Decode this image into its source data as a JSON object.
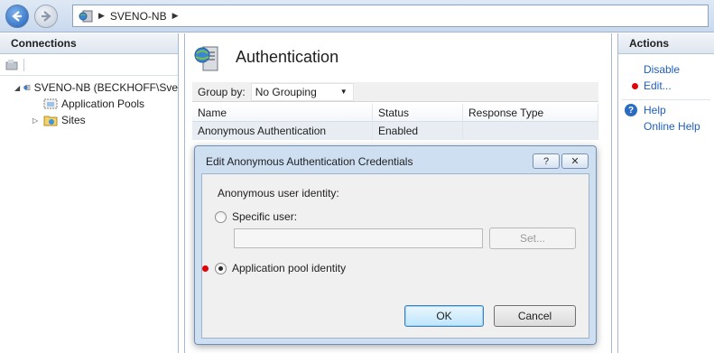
{
  "address_bar": {
    "path": [
      "SVENO-NB"
    ]
  },
  "connections": {
    "title": "Connections",
    "tree": {
      "server": "SVENO-NB (BECKHOFF\\Sve",
      "children": [
        "Application Pools",
        "Sites"
      ]
    }
  },
  "feature": {
    "title": "Authentication",
    "group_by_label": "Group by:",
    "group_by_value": "No Grouping",
    "columns": [
      "Name",
      "Status",
      "Response Type"
    ],
    "rows": [
      {
        "name": "Anonymous Authentication",
        "status": "Enabled",
        "response": ""
      }
    ]
  },
  "actions": {
    "title": "Actions",
    "items": [
      "Disable",
      "Edit..."
    ],
    "help_items": [
      "Help",
      "Online Help"
    ]
  },
  "dialog": {
    "title": "Edit Anonymous Authentication Credentials",
    "help_btn": "?",
    "close_btn": "✕",
    "identity_label": "Anonymous user identity:",
    "specific_user_label": "Specific user:",
    "specific_user_value": "",
    "set_button": "Set...",
    "app_pool_label": "Application pool identity",
    "ok_button": "OK",
    "cancel_button": "Cancel",
    "selected": "Application pool identity"
  }
}
